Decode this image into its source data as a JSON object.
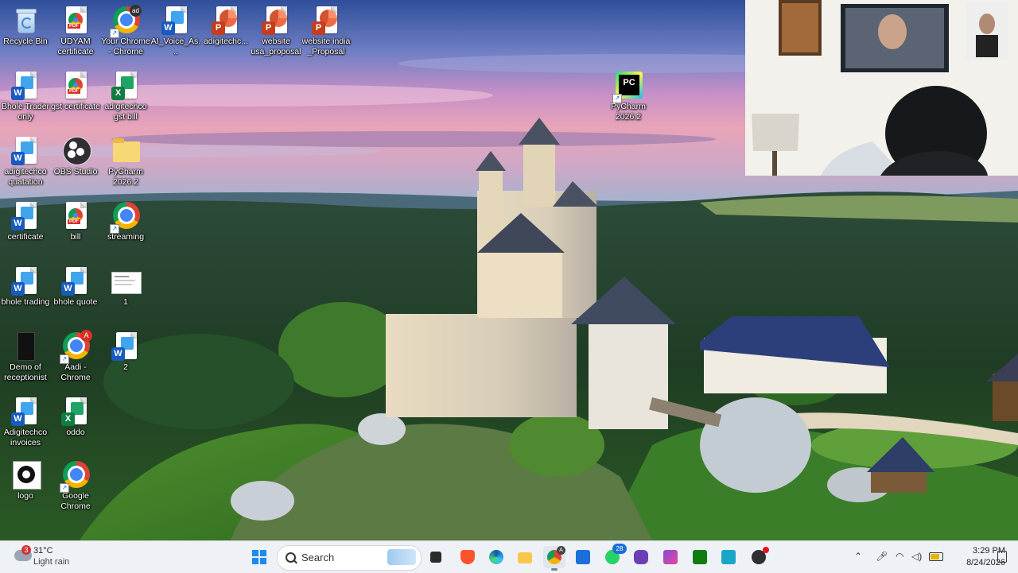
{
  "desktop": {
    "icons": [
      {
        "label": "Recycle Bin",
        "icon": "recycle-bin-icon"
      },
      {
        "label": "UDYAM certificate",
        "icon": "pdf-icon"
      },
      {
        "label": "Your Chrome - Chrome",
        "icon": "chrome-icon"
      },
      {
        "label": "AI_Voice_As...",
        "icon": "word-icon"
      },
      {
        "label": "adigitechc...",
        "icon": "powerpoint-icon"
      },
      {
        "label": "website usa_proposal",
        "icon": "powerpoint-icon"
      },
      {
        "label": "website india _Proposal",
        "icon": "powerpoint-icon"
      },
      {
        "label": "Bhole Trader only",
        "icon": "word-icon"
      },
      {
        "label": "gst certificate",
        "icon": "pdf-icon"
      },
      {
        "label": "adigitechco gst bill",
        "icon": "excel-icon"
      },
      {
        "label": "PyCharm 2026.2",
        "icon": "pycharm-icon"
      },
      {
        "label": "adigitechco quatation",
        "icon": "word-icon"
      },
      {
        "label": "OBS Studio",
        "icon": "obs-icon"
      },
      {
        "label": "PyCharm 2026.2",
        "icon": "folder-icon"
      },
      {
        "label": "certificate",
        "icon": "word-icon"
      },
      {
        "label": "bill",
        "icon": "pdf-icon"
      },
      {
        "label": "streaming",
        "icon": "chrome-icon"
      },
      {
        "label": "bhole trading",
        "icon": "word-icon"
      },
      {
        "label": "bhole quote",
        "icon": "word-icon"
      },
      {
        "label": "1",
        "icon": "image-file-icon"
      },
      {
        "label": "Demo of receptionist",
        "icon": "video-file-icon"
      },
      {
        "label": "Aadi - Chrome",
        "icon": "chrome-icon"
      },
      {
        "label": "2",
        "icon": "word-icon"
      },
      {
        "label": "Adigitechco invoices",
        "icon": "word-icon"
      },
      {
        "label": "oddo",
        "icon": "excel-icon"
      },
      {
        "label": "logo",
        "icon": "logo-file-icon"
      },
      {
        "label": "Google Chrome",
        "icon": "chrome-icon"
      }
    ]
  },
  "taskbar": {
    "weather": {
      "badge": "3",
      "temp": "31°C",
      "desc": "Light rain"
    },
    "search_placeholder": "Search",
    "chrome_badge": "A",
    "whatsapp_badge": "28",
    "clock": {
      "time": "3:29 PM",
      "date": "8/24/2026"
    }
  },
  "colors": {
    "word": "#185abd",
    "excel": "#107c41",
    "powerpoint": "#c43e1c",
    "pdf": "#d93025",
    "taskbar": "#eef1f6"
  }
}
